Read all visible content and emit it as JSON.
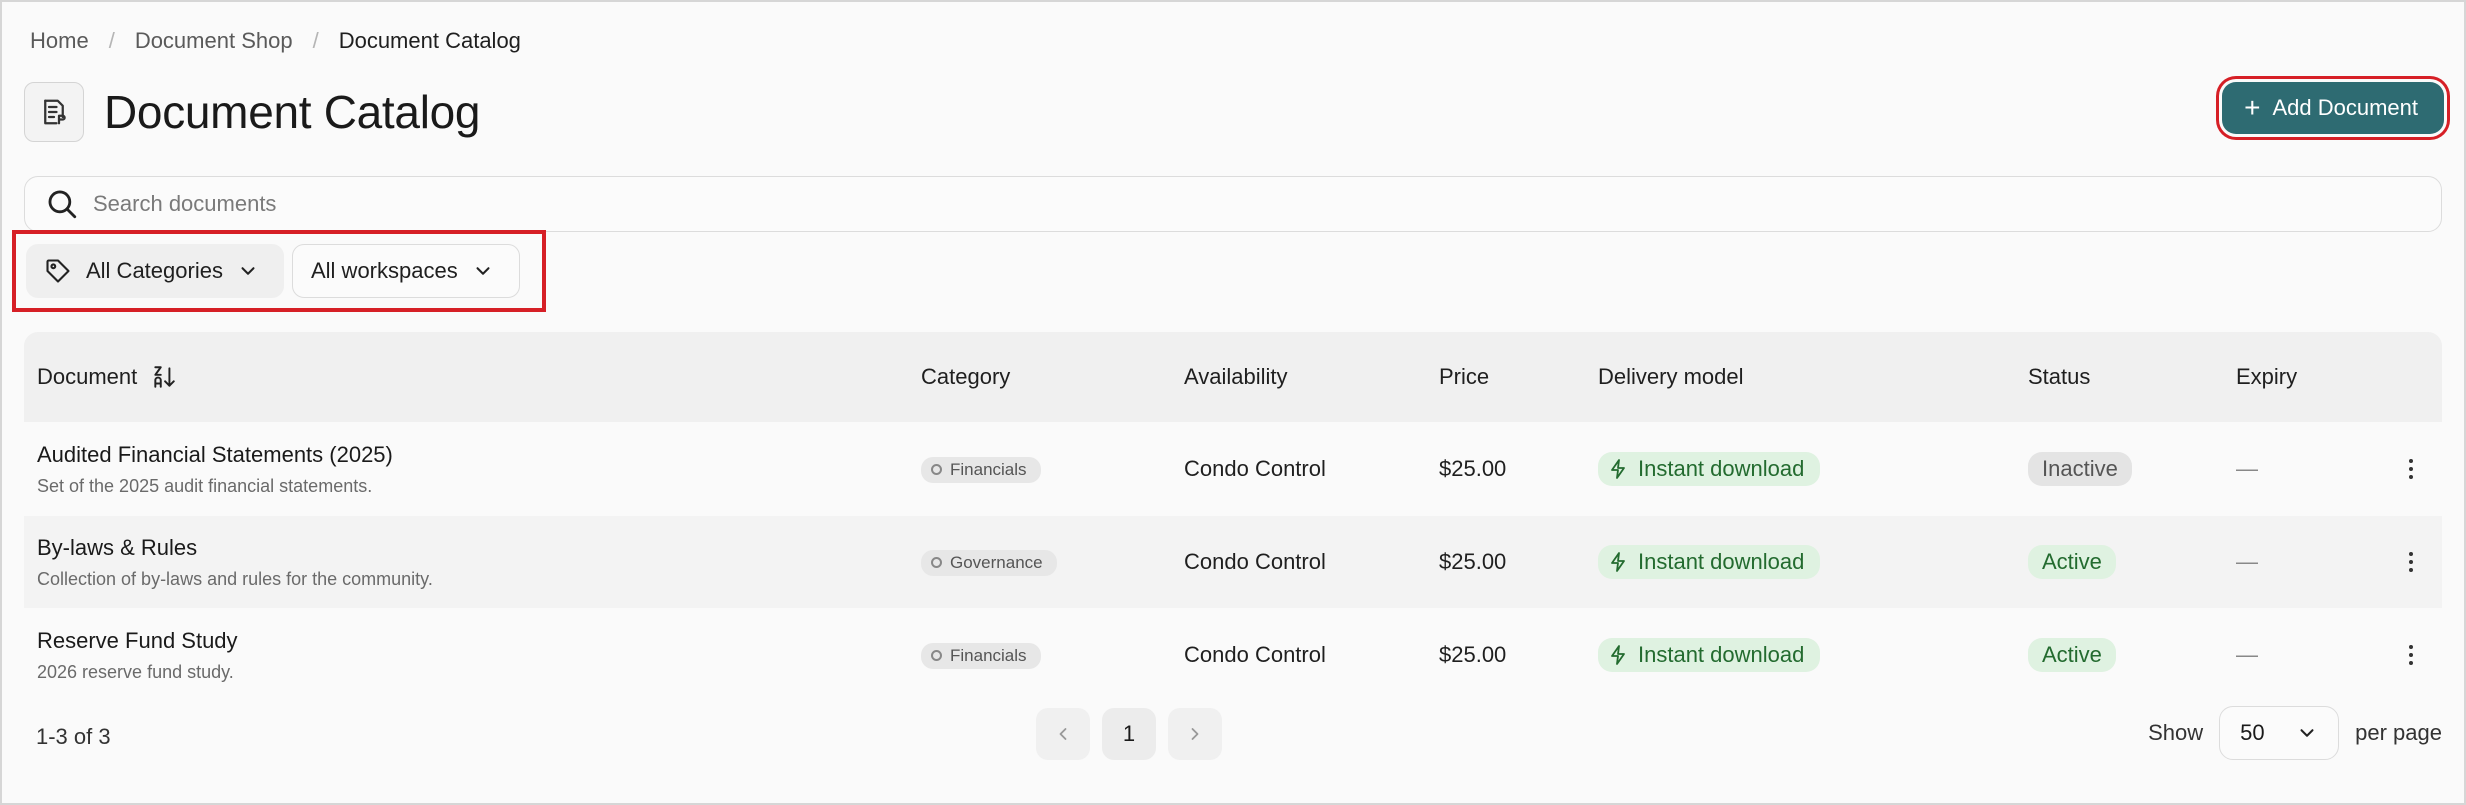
{
  "breadcrumb": {
    "home": "Home",
    "shop": "Document Shop",
    "current": "Document Catalog"
  },
  "page": {
    "title": "Document Catalog",
    "add_button": "Add Document"
  },
  "search": {
    "placeholder": "Search documents"
  },
  "filters": {
    "category": "All Categories",
    "workspace": "All workspaces"
  },
  "table": {
    "headers": {
      "document": "Document",
      "category": "Category",
      "availability": "Availability",
      "price": "Price",
      "delivery": "Delivery model",
      "status": "Status",
      "expiry": "Expiry"
    },
    "rows": [
      {
        "title": "Audited Financial Statements (2025)",
        "description": "Set of the 2025 audit financial statements.",
        "category": "Financials",
        "availability": "Condo Control",
        "price": "$25.00",
        "delivery": "Instant download",
        "status": "Inactive",
        "expiry": "—"
      },
      {
        "title": "By-laws & Rules",
        "description": "Collection of by-laws and rules for the community.",
        "category": "Governance",
        "availability": "Condo Control",
        "price": "$25.00",
        "delivery": "Instant download",
        "status": "Active",
        "expiry": "—"
      },
      {
        "title": "Reserve Fund Study",
        "description": "2026 reserve fund study.",
        "category": "Financials",
        "availability": "Condo Control",
        "price": "$25.00",
        "delivery": "Instant download",
        "status": "Active",
        "expiry": "—"
      }
    ]
  },
  "pagination": {
    "range": "1-3 of 3",
    "current_page": "1",
    "show_label": "Show",
    "per_page_value": "50",
    "per_page_label": "per page"
  },
  "colors": {
    "accent": "#2e6b72",
    "highlight": "#d61f26",
    "active_bg": "#dff2e1",
    "active_text": "#236b2f"
  }
}
